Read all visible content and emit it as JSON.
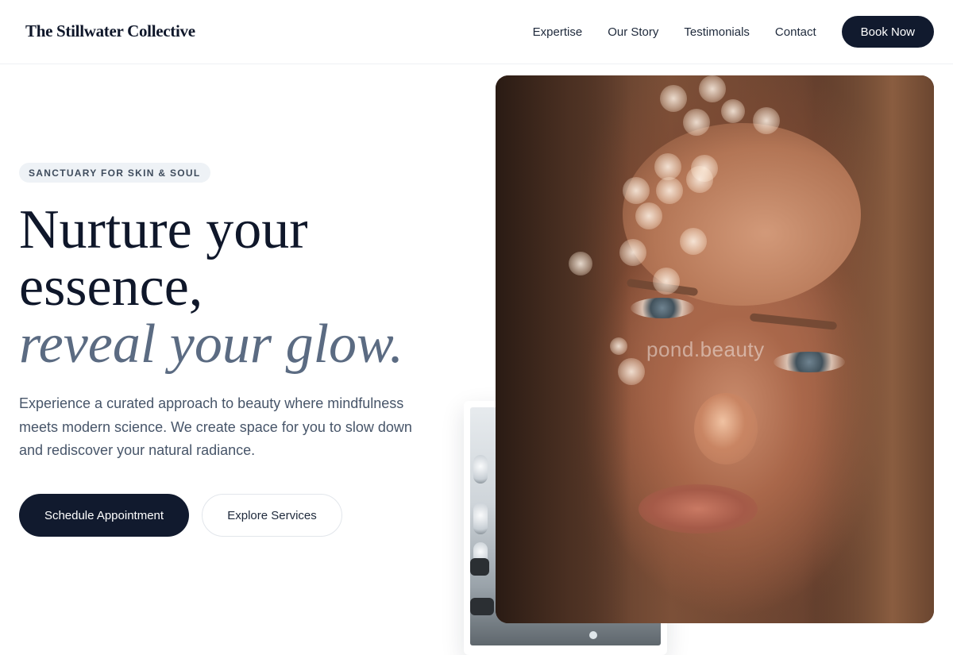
{
  "header": {
    "brand": "The Stillwater Collective",
    "nav": [
      "Expertise",
      "Our Story",
      "Testimonials",
      "Contact"
    ],
    "cta_label": "Book Now"
  },
  "hero": {
    "badge": "SANCTUARY FOR SKIN & SOUL",
    "headline": {
      "line1": "Nurture your",
      "line2": "essence,",
      "line3_accent": "reveal your glow."
    },
    "lead": "Experience a curated approach to beauty where mindfulness meets modern science. We create space for you to slow down and rediscover your natural radiance.",
    "primary_cta": "Schedule Appointment",
    "secondary_cta": "Explore Services"
  },
  "media": {
    "portrait_watermark": "pond.beauty"
  },
  "colors": {
    "navy": "#111a2e",
    "accent_text": "#5b6b82",
    "badge_bg": "#eef2f6"
  }
}
